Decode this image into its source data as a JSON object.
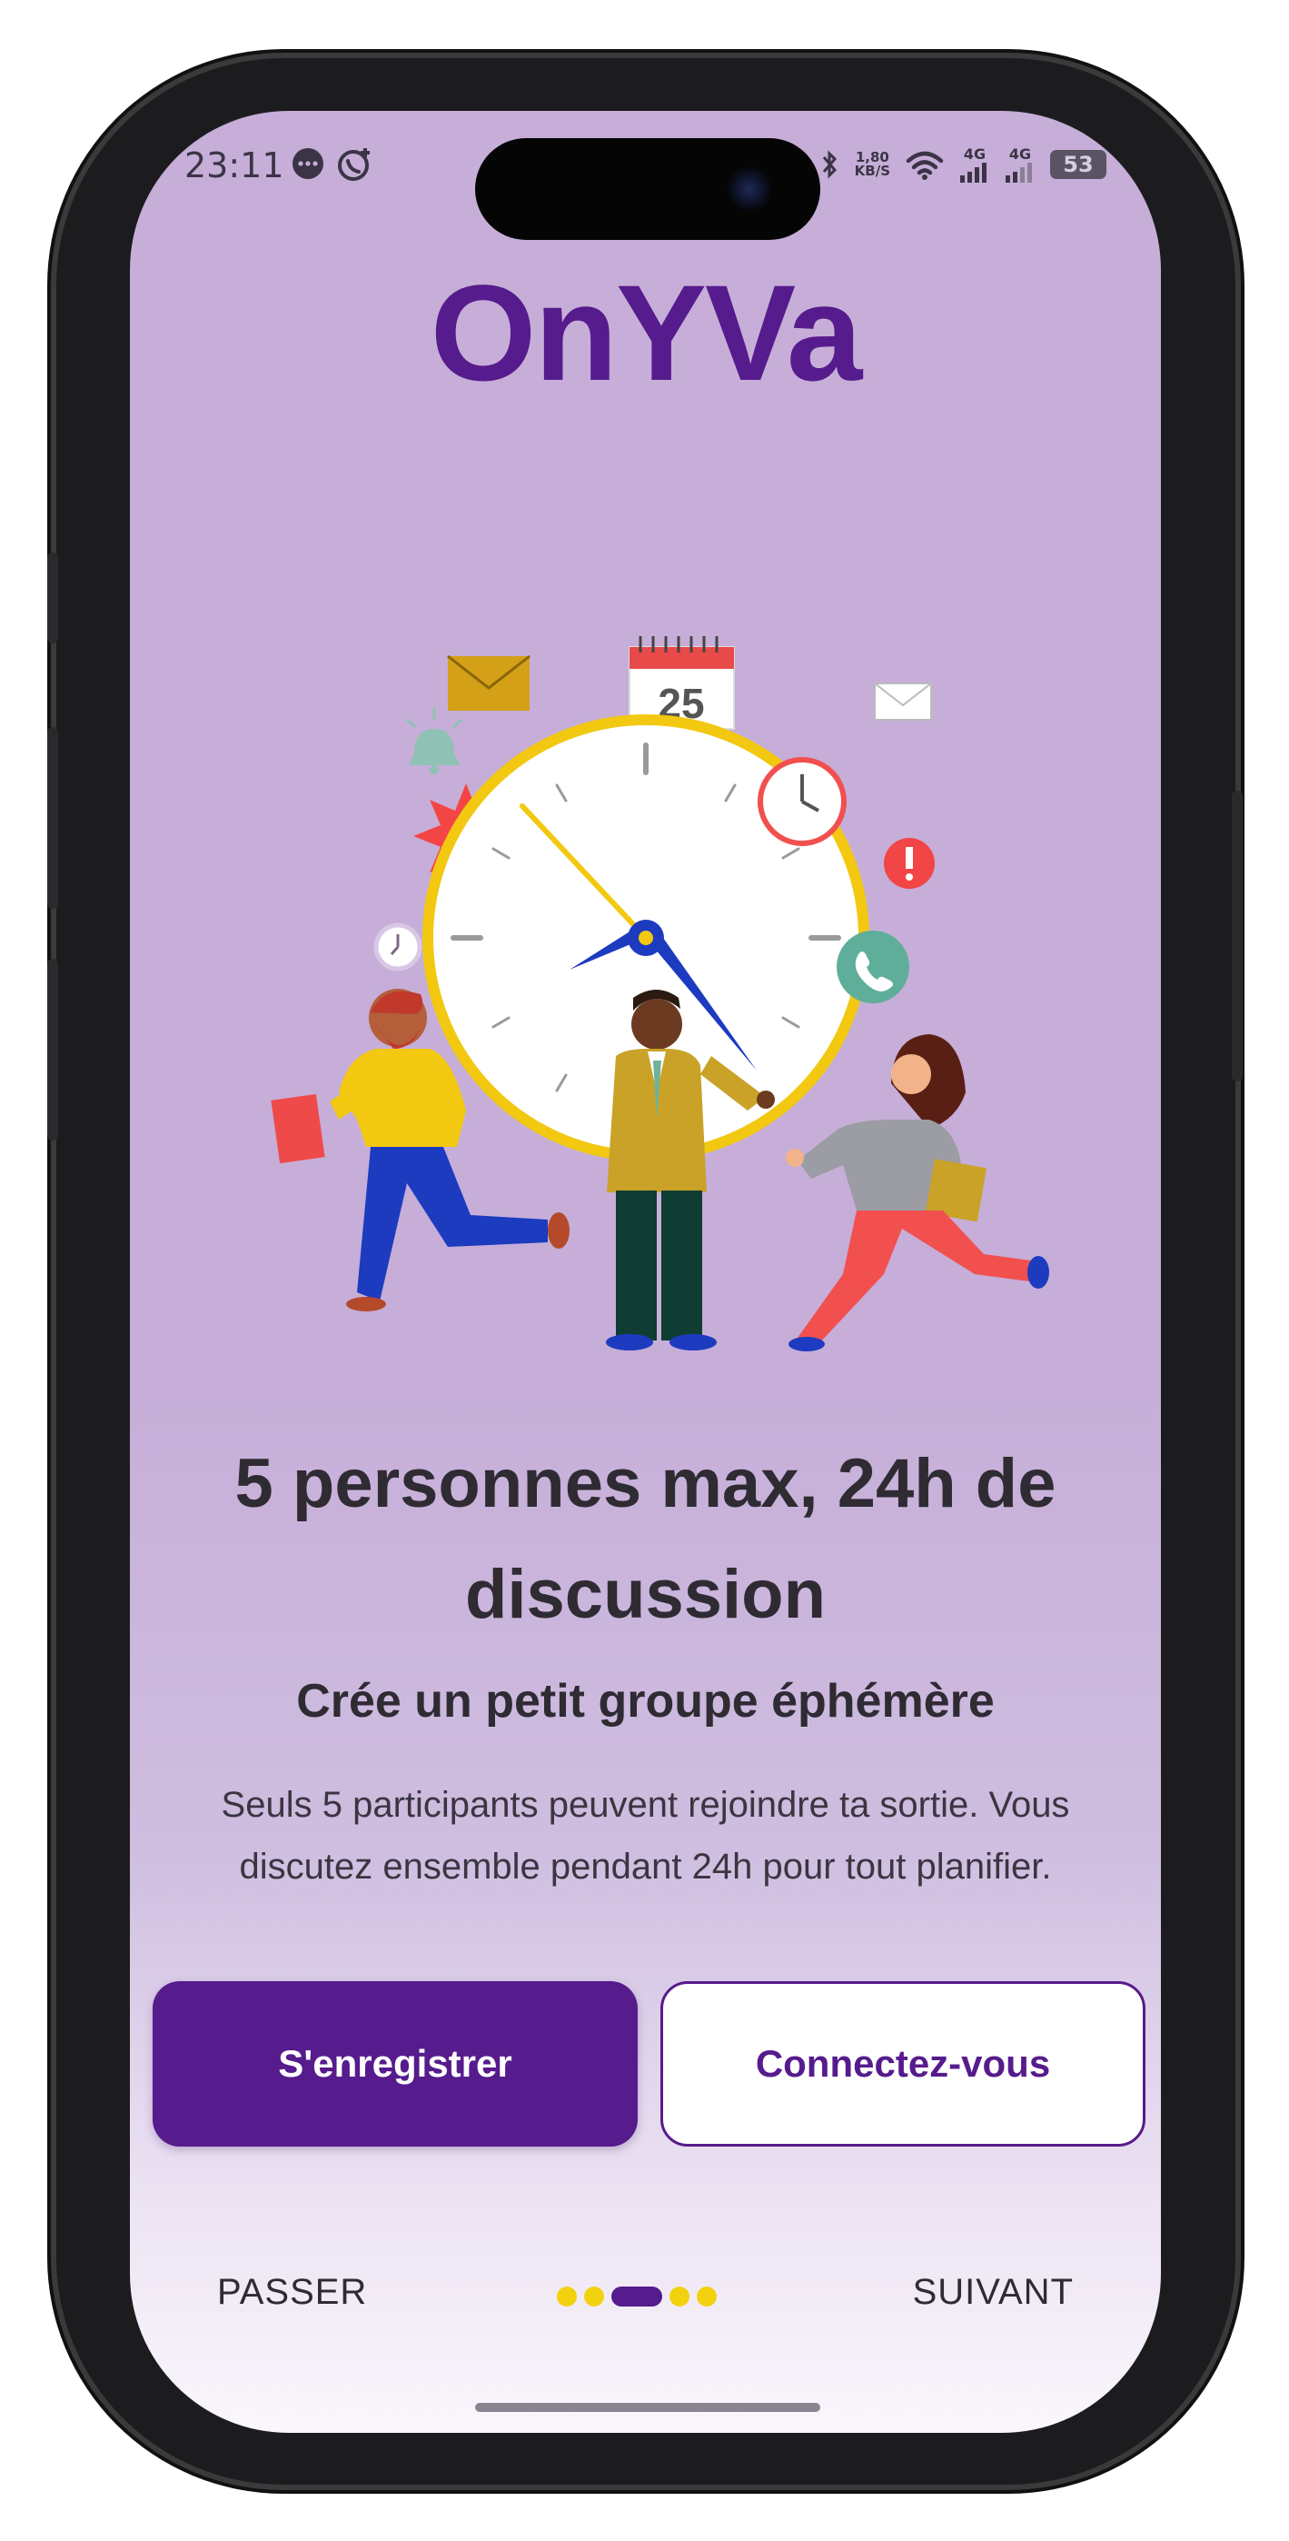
{
  "status_bar": {
    "time": "23:11",
    "speed_value": "1,80",
    "speed_unit": "KB/S",
    "network_1": "4G",
    "network_2": "4G",
    "battery": "53",
    "icons": [
      "chat-bubble-icon",
      "whatsapp-icon",
      "bluetooth-icon",
      "wifi-icon",
      "signal-icon",
      "battery-icon"
    ]
  },
  "app": {
    "logo": "OnYVa",
    "brand_color": "#561b8c",
    "accent_color": "#f2d20f"
  },
  "illustration": {
    "calendar_day": "25",
    "icons": [
      "envelope-icon",
      "calendar-icon",
      "envelope-icon",
      "bell-icon",
      "burst-icon",
      "clock-icon",
      "alert-icon",
      "phone-icon"
    ]
  },
  "onboarding": {
    "headline": "5 personnes max, 24h de discussion",
    "subtitle": "Crée un petit groupe éphémère",
    "description": "Seuls 5 participants peuvent rejoindre ta sortie. Vous discutez ensemble pendant 24h pour tout planifier.",
    "register_label": "S'enregistrer",
    "login_label": "Connectez-vous",
    "skip_label": "PASSER",
    "next_label": "SUIVANT",
    "page_count": 5,
    "current_page": 3
  }
}
